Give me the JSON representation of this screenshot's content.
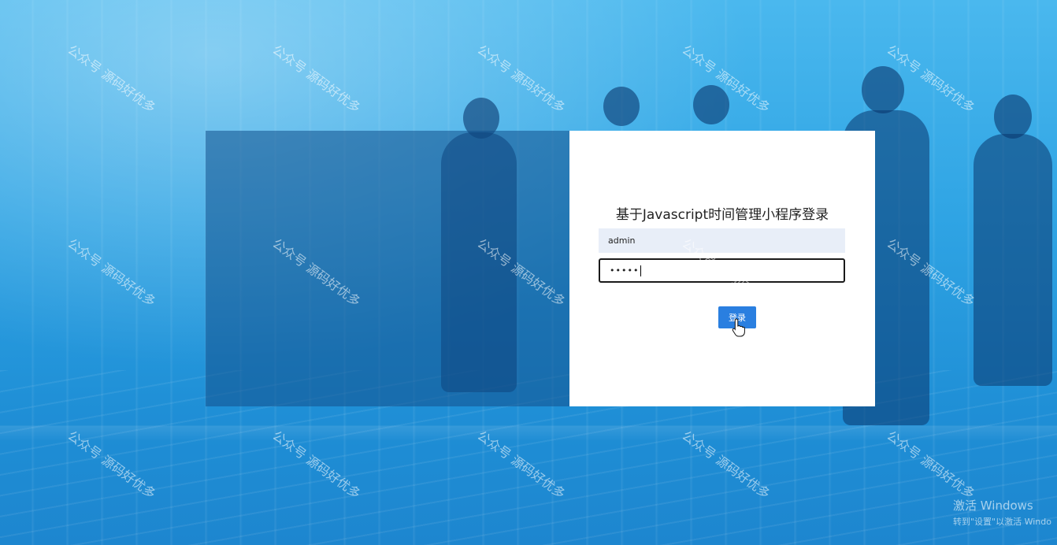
{
  "login": {
    "title": "基于Javascript时间管理小程序登录",
    "username_value": "admin",
    "password_value": "•••••",
    "login_button_label": "登录"
  },
  "watermark_text": "公众号 源码好优多",
  "os_overlay": {
    "line1": "激活 Windows",
    "line2": "转到\"设置\"以激活 Windo"
  },
  "colors": {
    "background_blue": "#2fa4e4",
    "login_button": "#2a7fe0",
    "username_field_bg": "#e8eef8"
  }
}
